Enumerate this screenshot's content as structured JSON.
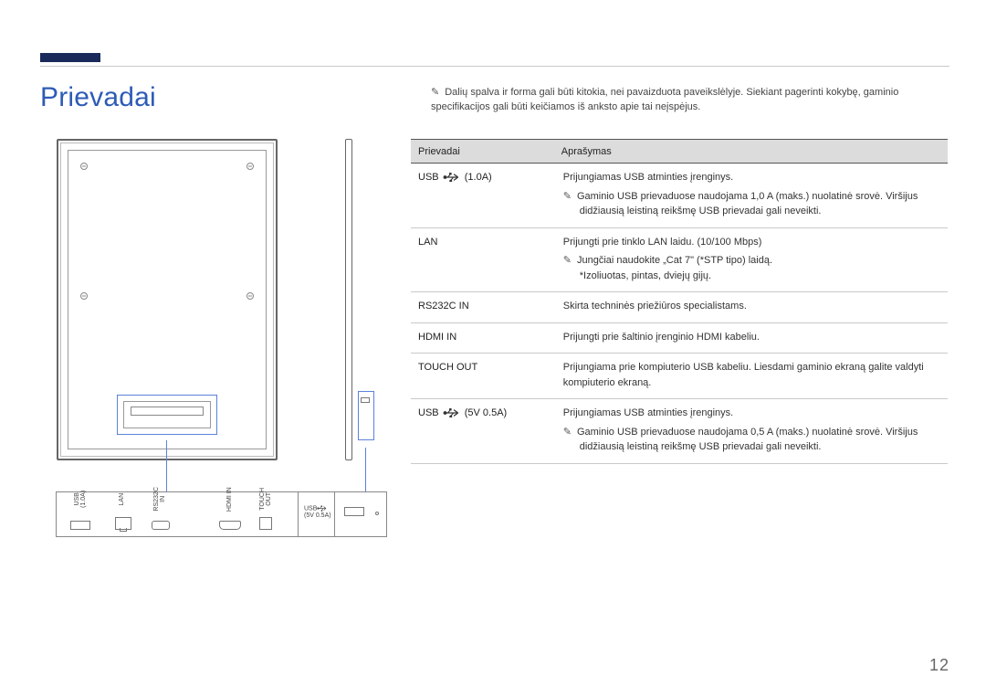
{
  "title": "Prievadai",
  "intro_note": "Dalių spalva ir forma gali būti kitokia, nei pavaizduota paveikslėlyje. Siekiant pagerinti kokybę, gaminio specifikacijos gali būti keičiamos iš anksto apie tai neįspėjus.",
  "page_number": "12",
  "diagram_labels": {
    "usb_1a": "USB",
    "usb_1a_sub": "(1.0A)",
    "lan": "LAN",
    "rs232c": "RS232C",
    "rs232c_sub": "IN",
    "hdmi": "HDMI IN",
    "touch": "TOUCH",
    "touch_sub": "OUT",
    "side_usb": "USB",
    "side_usb_sub": "(5V 0.5A)"
  },
  "table": {
    "headers": {
      "port": "Prievadai",
      "desc": "Aprašymas"
    },
    "rows": [
      {
        "port_prefix": "USB ",
        "port_suffix": " (1.0A)",
        "desc_main": "Prijungiamas USB atminties įrenginys.",
        "desc_note": "Gaminio USB prievaduose naudojama 1,0 A (maks.) nuolatinė srovė. Viršijus didžiausią leistiną reikšmę USB prievadai gali neveikti.",
        "has_icon": true
      },
      {
        "port": "LAN",
        "desc_main": "Prijungti prie tinklo LAN laidu. (10/100 Mbps)",
        "desc_note": "Jungčiai naudokite „Cat 7\" (*STP tipo) laidą.",
        "desc_sub": "*Izoliuotas, pintas, dviejų gijų."
      },
      {
        "port": "RS232C IN",
        "desc_main": "Skirta techninės priežiūros specialistams."
      },
      {
        "port": "HDMI IN",
        "desc_main": "Prijungti prie šaltinio įrenginio HDMI kabeliu."
      },
      {
        "port": "TOUCH OUT",
        "desc_main": "Prijungiama prie kompiuterio USB kabeliu. Liesdami gaminio ekraną galite valdyti kompiuterio ekraną."
      },
      {
        "port_prefix": "USB ",
        "port_suffix": " (5V 0.5A)",
        "desc_main": "Prijungiamas USB atminties įrenginys.",
        "desc_note": "Gaminio USB prievaduose naudojama 0,5 A (maks.) nuolatinė srovė. Viršijus didžiausią leistiną reikšmę USB prievadai gali neveikti.",
        "has_icon": true
      }
    ]
  }
}
